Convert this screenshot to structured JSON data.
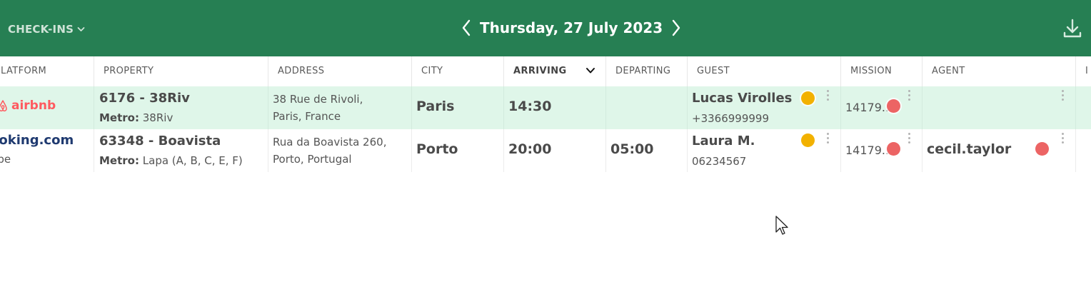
{
  "header": {
    "view_label": "CHECK-INS",
    "date": "Thursday, 27 July 2023",
    "brand_color": "#267f53"
  },
  "columns": [
    {
      "label": "LATFORM"
    },
    {
      "label": "PROPERTY"
    },
    {
      "label": "ADDRESS"
    },
    {
      "label": "CITY"
    },
    {
      "label": "ARRIVING",
      "sorted": true
    },
    {
      "label": "DEPARTING"
    },
    {
      "label": "GUEST"
    },
    {
      "label": "MISSION"
    },
    {
      "label": "AGENT"
    },
    {
      "label": "I"
    }
  ],
  "rows": [
    {
      "highlighted": true,
      "platform_logo": "airbnb",
      "platform_sub": "",
      "property_title": "6176 - 38Riv",
      "metro_label": "Metro:",
      "metro_value": "38Riv",
      "address_line1": "38 Rue de Rivoli,",
      "address_line2": "Paris, France",
      "city": "Paris",
      "arriving": "14:30",
      "departing": "",
      "guest_name": "Lucas Virolles",
      "guest_phone": "+3366999999",
      "guest_status_color": "#f2b100",
      "mission_id": "14179...",
      "mission_status_color": "#ec6464",
      "agent": "",
      "agent_status_color": ""
    },
    {
      "highlighted": false,
      "platform_logo": "ooking.com",
      "platform_sub": "ripe",
      "property_title": "63348 - Boavista",
      "metro_label": "Metro:",
      "metro_value": "Lapa (A, B, C, E, F)",
      "address_line1": "Rua da Boavista 260,",
      "address_line2": "Porto, Portugal",
      "city": "Porto",
      "arriving": "20:00",
      "departing": "05:00",
      "guest_name": "Laura M.",
      "guest_phone": "06234567",
      "guest_status_color": "#f2b100",
      "mission_id": "14179...",
      "mission_status_color": "#ec6464",
      "agent": "cecil.taylor",
      "agent_status_color": "#ec6464"
    }
  ]
}
